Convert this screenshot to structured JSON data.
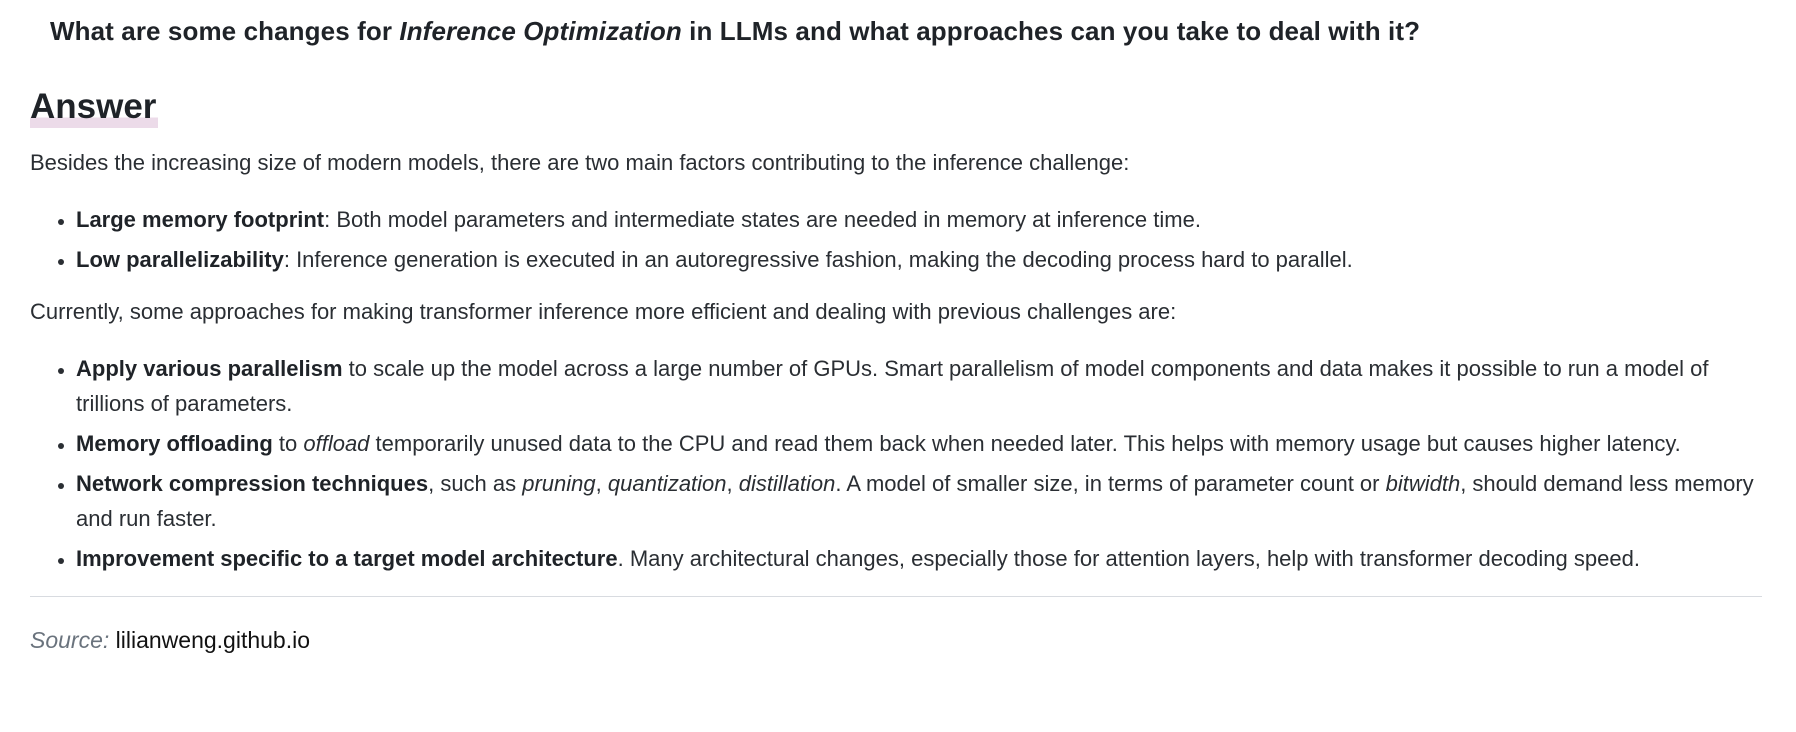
{
  "question": {
    "before": "What are some changes for ",
    "emphasis": "Inference Optimization",
    "after": " in LLMs and what approaches can you take to deal with it?"
  },
  "answer_heading": "Answer",
  "intro": "Besides the increasing size of modern models, there are two main factors contributing to the inference challenge:",
  "factors": [
    {
      "term": "Large memory footprint",
      "text": ": Both model parameters and intermediate states are needed in memory at inference time."
    },
    {
      "term": "Low parallelizability",
      "text": ": Inference generation is executed in an autoregressive fashion, making the decoding process hard to parallel."
    }
  ],
  "approaches_intro": "Currently, some approaches for making transformer inference more efficient and dealing with previous challenges are:",
  "approaches": [
    {
      "term": "Apply various parallelism",
      "text": " to scale up the model across a large number of GPUs. Smart parallelism of model components and data makes it possible to run a model of trillions of parameters."
    },
    {
      "term": "Memory offloading",
      "pre": " to ",
      "em": "offload",
      "text": " temporarily unused data to the CPU and read them back when needed later. This helps with memory usage but causes higher latency."
    },
    {
      "term": "Network compression techniques",
      "pre": ", such as ",
      "em1": "pruning",
      "sep1": ", ",
      "em2": "quantization",
      "sep2": ", ",
      "em3": "distillation",
      "mid": ". A model of smaller size, in terms of parameter count or ",
      "em4": "bitwidth",
      "text": ", should demand less memory and run faster."
    },
    {
      "term": "Improvement specific to a target model architecture",
      "text": ". Many architectural changes, especially those for attention layers, help with transformer decoding speed."
    }
  ],
  "source": {
    "label": "Source:",
    "link_text": "lilianweng.github.io"
  }
}
